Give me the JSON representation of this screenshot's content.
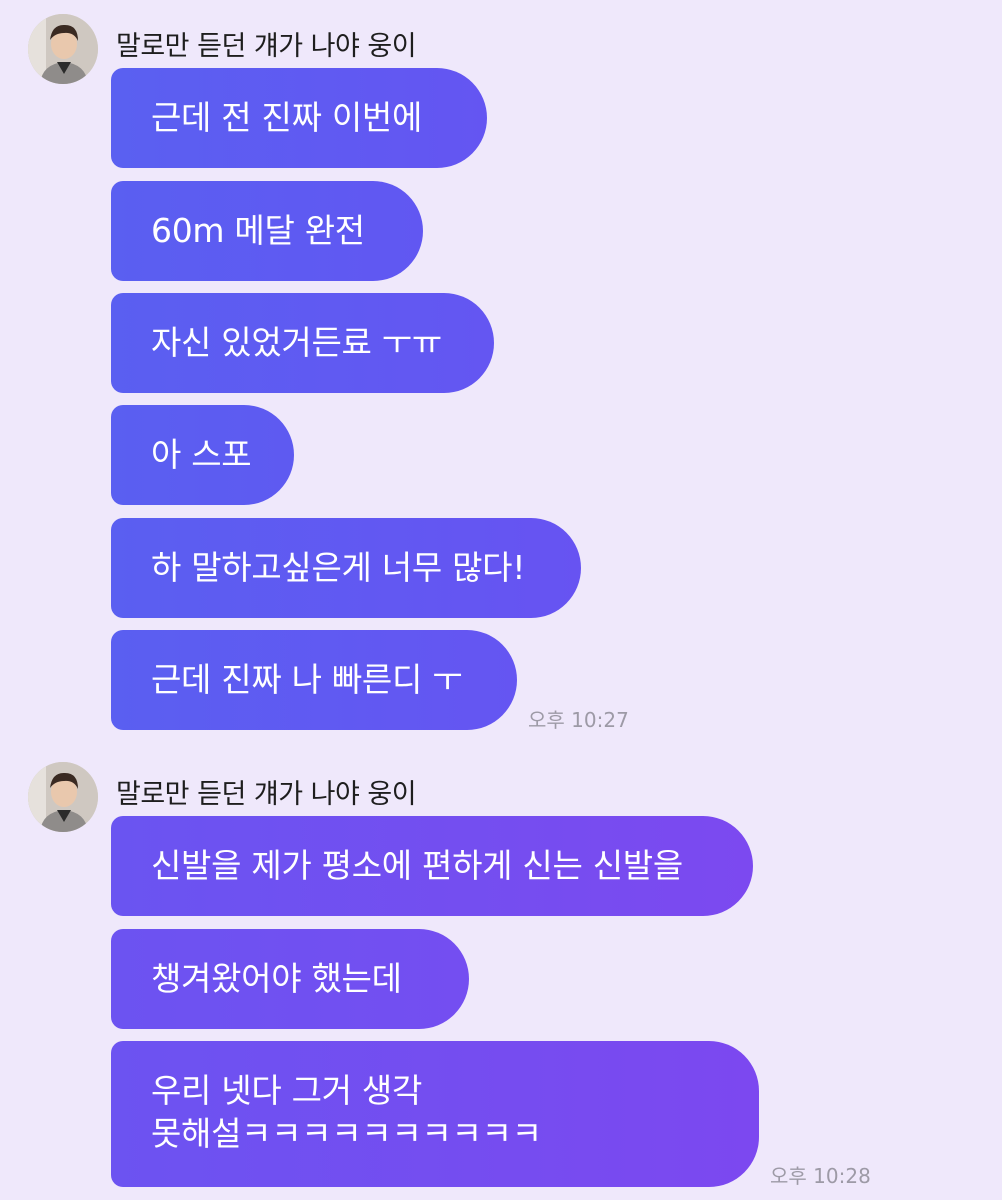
{
  "groups": [
    {
      "sender": "말로만 듣던 걔가 나야 웅이",
      "avatar_icon": "profile-photo",
      "messages": [
        "근데 전 진짜 이번에",
        "60m 메달 완전",
        "자신 있었거든료 ㅜㅠ",
        "아 스포",
        "하 말하고싶은게 너무 많다!",
        "근데 진짜 나 빠른디 ㅜ"
      ],
      "time": "오후 10:27"
    },
    {
      "sender": "말로만 듣던 걔가 나야 웅이",
      "avatar_icon": "profile-photo",
      "messages": [
        "신발을 제가 평소에 편하게 신는 신발을",
        "챙겨왔어야 했는데"
      ],
      "multiline_message": [
        "우리 넷다 그거 생각",
        "못해설ㅋㅋㅋㅋㅋㅋㅋㅋㅋㅋ"
      ],
      "time": "오후 10:28"
    }
  ],
  "colors": {
    "background": "#efe8fb",
    "bubble_gradient_start": "#5b5ff0",
    "bubble_gradient_end": "#7a4af0",
    "time_text": "#9d9aa6"
  }
}
